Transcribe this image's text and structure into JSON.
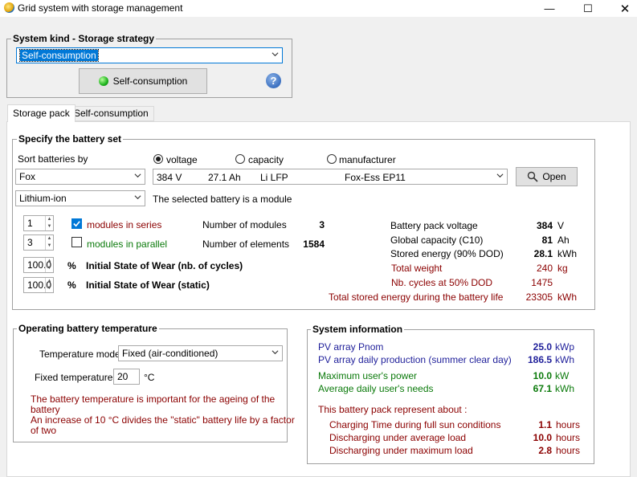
{
  "window": {
    "title": "Grid system with storage management",
    "minimize": "—",
    "maximize": "☐",
    "close": "✕"
  },
  "system_kind": {
    "group_label": "System kind - Storage strategy",
    "selected": "Self-consumption",
    "button_label": "Self-consumption",
    "help": "?"
  },
  "tabs": [
    {
      "label": "Storage pack"
    },
    {
      "label": "Self-consumption"
    }
  ],
  "battery_set": {
    "group_label": "Specify the battery set",
    "sort_label": "Sort batteries by",
    "sort_options": [
      "voltage",
      "capacity",
      "manufacturer"
    ],
    "manufacturer": "Fox",
    "technology": "Lithium-ion",
    "battery": {
      "voltage": "384 V",
      "capacity": "27.1 Ah",
      "chem": "Li  LFP",
      "model": "Fox-Ess EP11"
    },
    "open_button": "Open",
    "module_note": "The selected battery is a module",
    "series_value": "1",
    "series_label": "modules in series",
    "parallel_value": "3",
    "parallel_label": "modules in parallel",
    "wear_cycles_value": "100.0",
    "wear_cycles_unit": "%",
    "wear_cycles_label": "Initial State of Wear (nb. of cycles)",
    "wear_static_value": "100.0",
    "wear_static_unit": "%",
    "wear_static_label": "Initial State of Wear (static)",
    "num_modules_label": "Number of modules",
    "num_modules": "3",
    "num_elements_label": "Number of elements",
    "num_elements": "1584",
    "results": [
      {
        "label": "Battery pack voltage",
        "value": "384",
        "unit": "V"
      },
      {
        "label": "Global capacity (C10)",
        "value": "81",
        "unit": "Ah"
      },
      {
        "label": "Stored energy (90% DOD)",
        "value": "28.1",
        "unit": "kWh"
      },
      {
        "label": "Total weight",
        "value": "240",
        "unit": "kg"
      },
      {
        "label": "Nb. cycles at 50% DOD",
        "value": "1475",
        "unit": ""
      },
      {
        "label": "Total stored energy during the battery life",
        "value": "23305",
        "unit": "kWh"
      }
    ]
  },
  "temperature": {
    "group_label": "Operating battery temperature",
    "mode_label": "Temperature mode",
    "mode_value": "Fixed (air-conditioned)",
    "fixed_label": "Fixed temperature",
    "fixed_value": "20",
    "fixed_unit": "°C",
    "note1": "The battery temperature is important for the ageing of the",
    "note2": "battery",
    "note3": "An increase of 10 °C divides the \"static\" battery life by a factor",
    "note4": "of two"
  },
  "system_info": {
    "group_label": "System information",
    "pv_pnom_label": "PV array Pnom",
    "pv_pnom": "25.0",
    "pv_pnom_unit": "kWp",
    "pv_daily_label": "PV array daily production (summer clear day)",
    "pv_daily": "186.5",
    "pv_daily_unit": "kWh",
    "max_power_label": "Maximum user's power",
    "max_power": "10.0",
    "max_power_unit": "kW",
    "avg_needs_label": "Average daily user's needs",
    "avg_needs": "67.1",
    "avg_needs_unit": "kWh",
    "represent_label": "This battery pack represent about :",
    "charging_label": "Charging Time during full sun conditions",
    "charging": "1.1",
    "charging_unit": "hours",
    "dis_avg_label": "Discharging under average load",
    "dis_avg": "10.0",
    "dis_avg_unit": "hours",
    "dis_max_label": "Discharging under maximum load",
    "dis_max": "2.8",
    "dis_max_unit": "hours"
  },
  "colors": {
    "accent": "#0078d7",
    "red": "#8b0000",
    "green": "#0b7a0b",
    "blue": "#1f1f9a"
  }
}
